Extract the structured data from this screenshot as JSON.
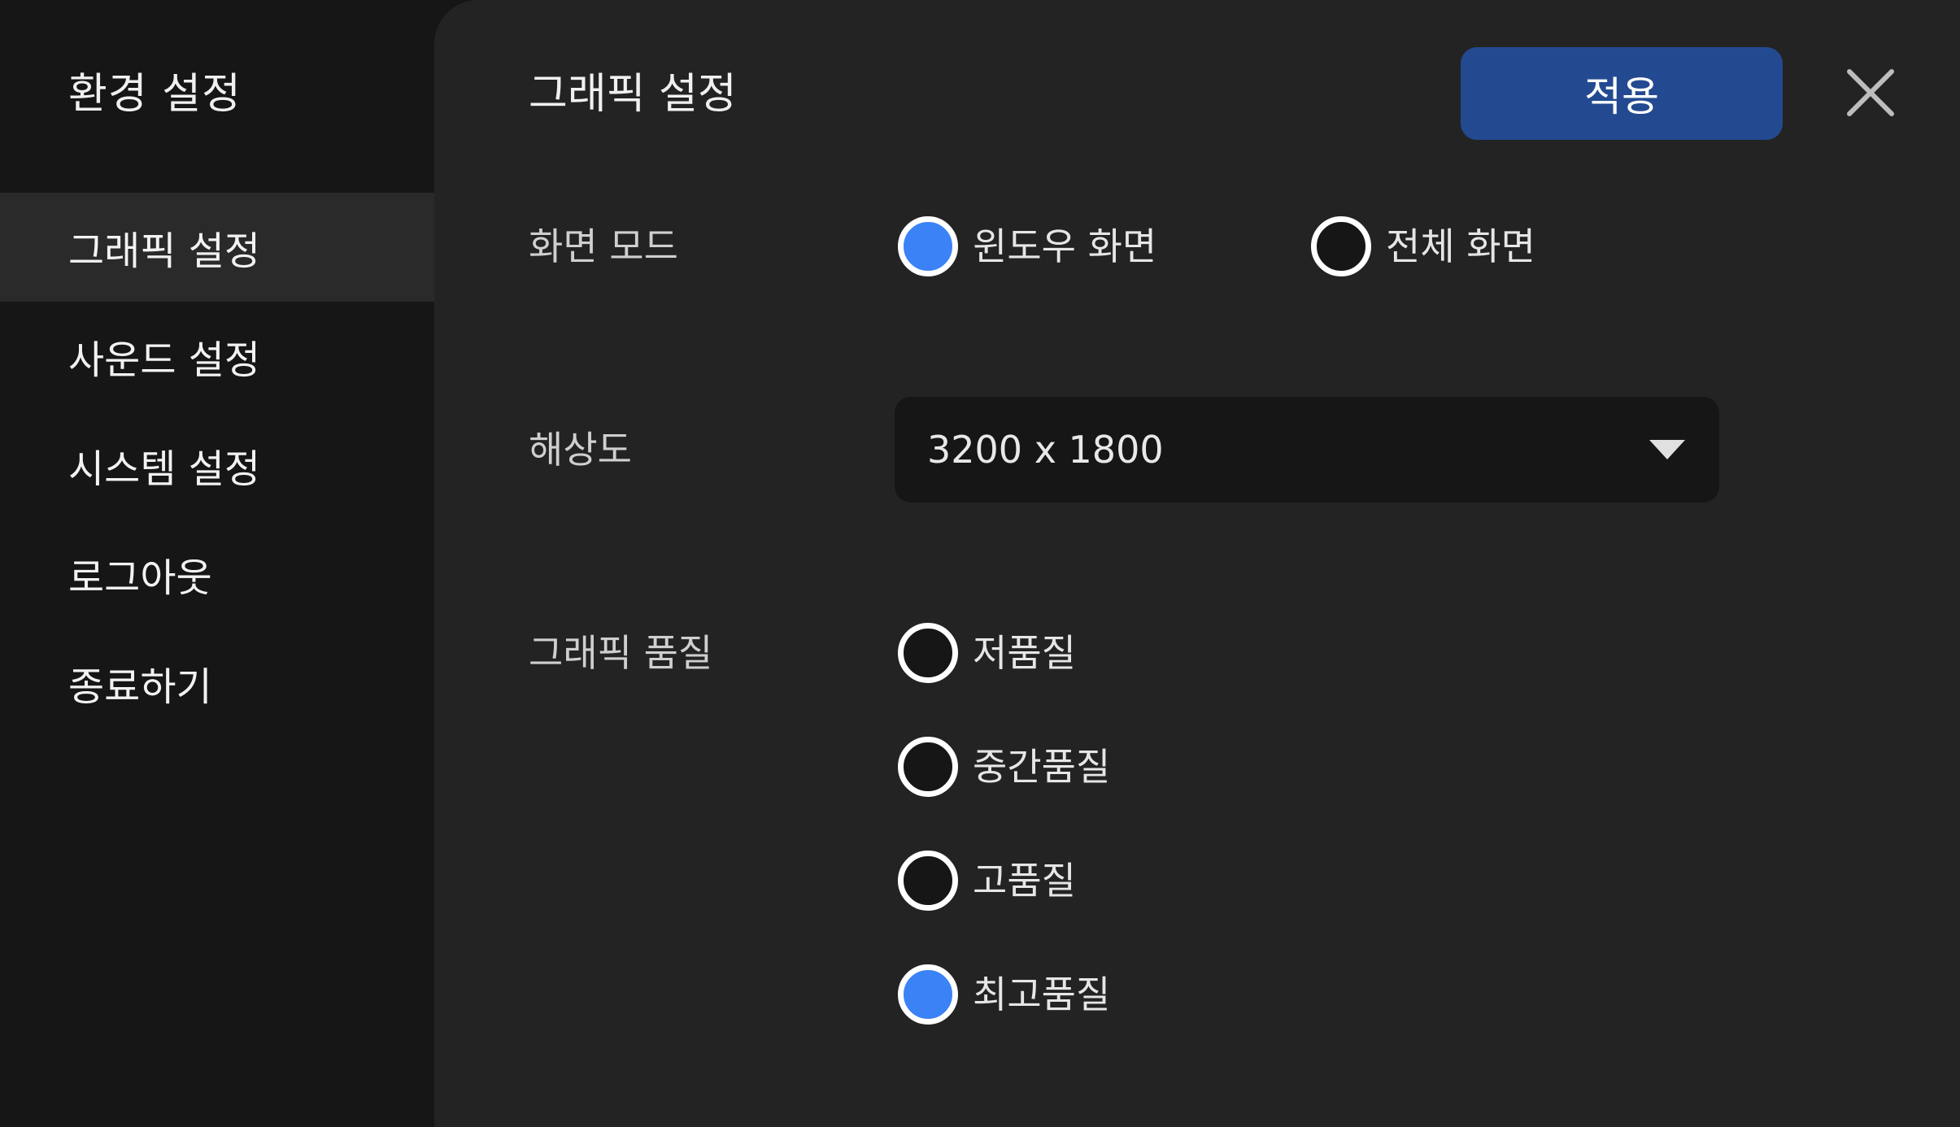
{
  "sidebar": {
    "title": "환경 설정",
    "items": [
      {
        "label": "그래픽 설정",
        "active": true
      },
      {
        "label": "사운드 설정",
        "active": false
      },
      {
        "label": "시스템 설정",
        "active": false
      },
      {
        "label": "로그아웃",
        "active": false
      },
      {
        "label": "종료하기",
        "active": false
      }
    ]
  },
  "panel": {
    "title": "그래픽 설정",
    "apply_label": "적용",
    "close_icon": "close-icon",
    "screen_mode": {
      "label": "화면 모드",
      "options": [
        {
          "label": "윈도우 화면",
          "checked": true
        },
        {
          "label": "전체 화면",
          "checked": false
        }
      ]
    },
    "resolution": {
      "label": "해상도",
      "value": "3200 x 1800",
      "icon": "chevron-down-icon"
    },
    "quality": {
      "label": "그래픽 품질",
      "options": [
        {
          "label": "저품질",
          "checked": false
        },
        {
          "label": "중간품질",
          "checked": false
        },
        {
          "label": "고품질",
          "checked": false
        },
        {
          "label": "최고품질",
          "checked": true
        }
      ]
    }
  },
  "colors": {
    "accent": "#3b82f6",
    "button": "#234a91",
    "sidebar_bg": "#161616",
    "panel_bg": "#232323"
  }
}
